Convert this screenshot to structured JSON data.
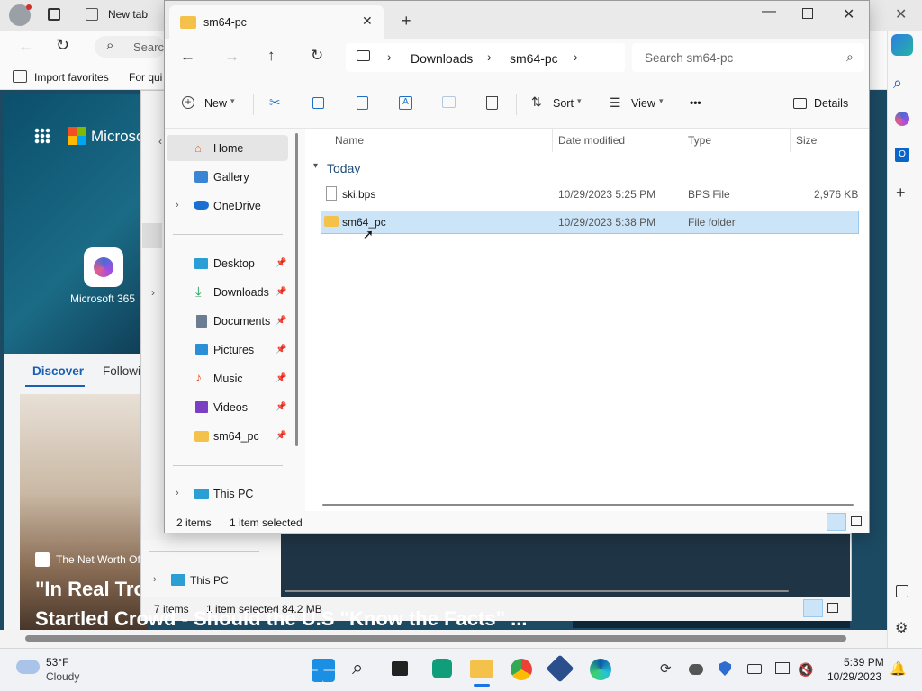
{
  "browser": {
    "tab_title": "New tab",
    "search_placeholder": "Search",
    "favorites": {
      "import": "Import favorites",
      "quick": "For qui"
    }
  },
  "newtab": {
    "brand": "Microso",
    "m365_label": "Microsoft 365",
    "tabs": {
      "discover": "Discover",
      "following": "Followi"
    },
    "news_source": "The Net Worth Of",
    "headline_line1": "\"In Real Tro",
    "headline_line2": "Startled Crowd - Should the U.S \"Know the Facts\" ..."
  },
  "back_explorer": {
    "nav_this_pc": "This PC",
    "status_items": "7 items",
    "status_selected": "1 item selected  84.2 MB"
  },
  "explorer": {
    "tab_title": "sm64-pc",
    "breadcrumb": [
      "Downloads",
      "sm64-pc"
    ],
    "search_placeholder": "Search sm64-pc",
    "commands": {
      "new": "New",
      "sort": "Sort",
      "view": "View",
      "more": "•••",
      "details": "Details"
    },
    "nav": {
      "home": "Home",
      "gallery": "Gallery",
      "onedrive": "OneDrive",
      "desktop": "Desktop",
      "downloads": "Downloads",
      "documents": "Documents",
      "pictures": "Pictures",
      "music": "Music",
      "videos": "Videos",
      "sm64_pc": "sm64_pc",
      "this_pc": "This PC"
    },
    "columns": {
      "name": "Name",
      "date": "Date modified",
      "type": "Type",
      "size": "Size"
    },
    "group": "Today",
    "files": [
      {
        "name": "ski.bps",
        "date": "10/29/2023 5:25 PM",
        "type": "BPS File",
        "size": "2,976 KB"
      },
      {
        "name": "sm64_pc",
        "date": "10/29/2023 5:38 PM",
        "type": "File folder",
        "size": ""
      }
    ],
    "status_items": "2 items",
    "status_selected": "1 item selected"
  },
  "taskbar": {
    "weather_temp": "53°F",
    "weather_desc": "Cloudy",
    "time": "5:39 PM",
    "date": "10/29/2023"
  }
}
